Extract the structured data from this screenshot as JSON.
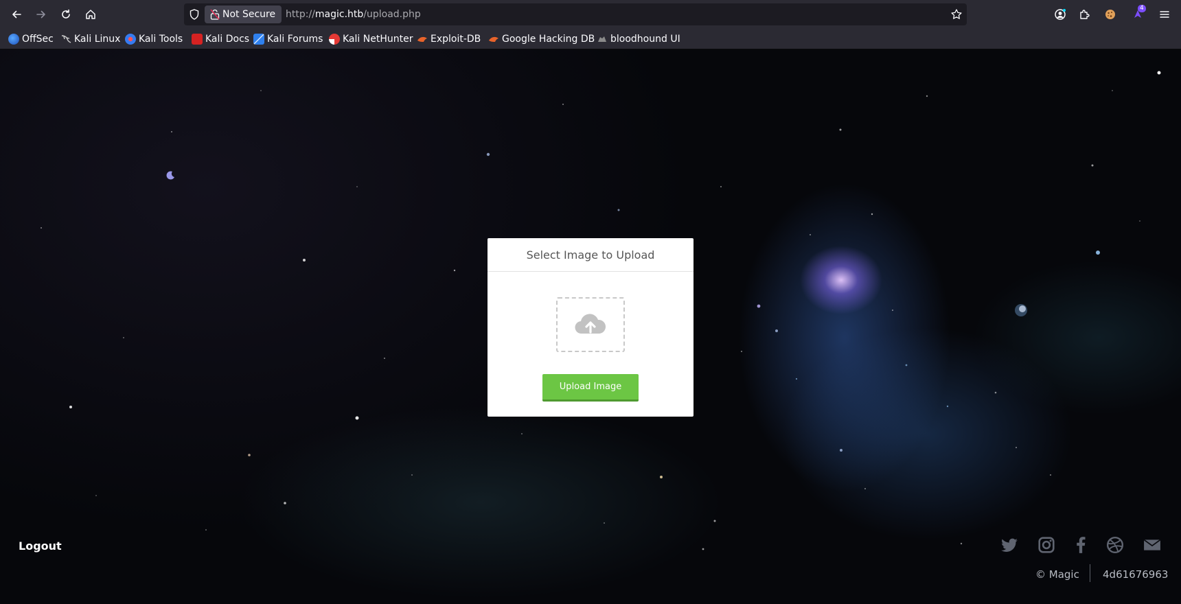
{
  "browser": {
    "security_label": "Not Secure",
    "url_scheme": "http://",
    "url_host": "magic.htb",
    "url_path": "/upload.php",
    "extension_badge": "4",
    "icons": {
      "back": "back-arrow-icon",
      "forward": "forward-arrow-icon",
      "reload": "reload-icon",
      "home": "home-icon",
      "shield": "tracking-shield-icon",
      "lock": "broken-lock-icon",
      "bookmark": "star-icon",
      "account": "account-icon",
      "extensions": "puzzle-icon",
      "cookie": "cookie-extension-icon",
      "menu": "hamburger-menu-icon"
    }
  },
  "bookmarks": [
    {
      "label": "OffSec",
      "icon": "offsec-icon",
      "color": "#3a7bd5"
    },
    {
      "label": "Kali Linux",
      "icon": "kali-dragon-icon",
      "color": "#cccccc"
    },
    {
      "label": "Kali Tools",
      "icon": "kali-tools-icon",
      "color": "#367bf0"
    },
    {
      "label": "Kali Docs",
      "icon": "kali-docs-icon",
      "color": "#d62222"
    },
    {
      "label": "Kali Forums",
      "icon": "kali-forums-icon",
      "color": "#2f80ed"
    },
    {
      "label": "Kali NetHunter",
      "icon": "nethunter-icon",
      "color": "#e53935"
    },
    {
      "label": "Exploit-DB",
      "icon": "exploit-db-icon",
      "color": "#e8632a"
    },
    {
      "label": "Google Hacking DB",
      "icon": "ghdb-icon",
      "color": "#e8632a"
    },
    {
      "label": "bloodhound UI",
      "icon": "bloodhound-icon",
      "color": "#8a8a8a"
    }
  ],
  "upload": {
    "title": "Select Image to Upload",
    "dropzone_icon": "cloud-upload-icon",
    "button_label": "Upload Image",
    "button_color": "#6cc644"
  },
  "footer": {
    "logout_label": "Logout",
    "social_icons": [
      "twitter-icon",
      "instagram-icon",
      "facebook-icon",
      "dribbble-icon",
      "envelope-icon"
    ],
    "copyright": "© Magic",
    "hash": "4d61676963"
  }
}
